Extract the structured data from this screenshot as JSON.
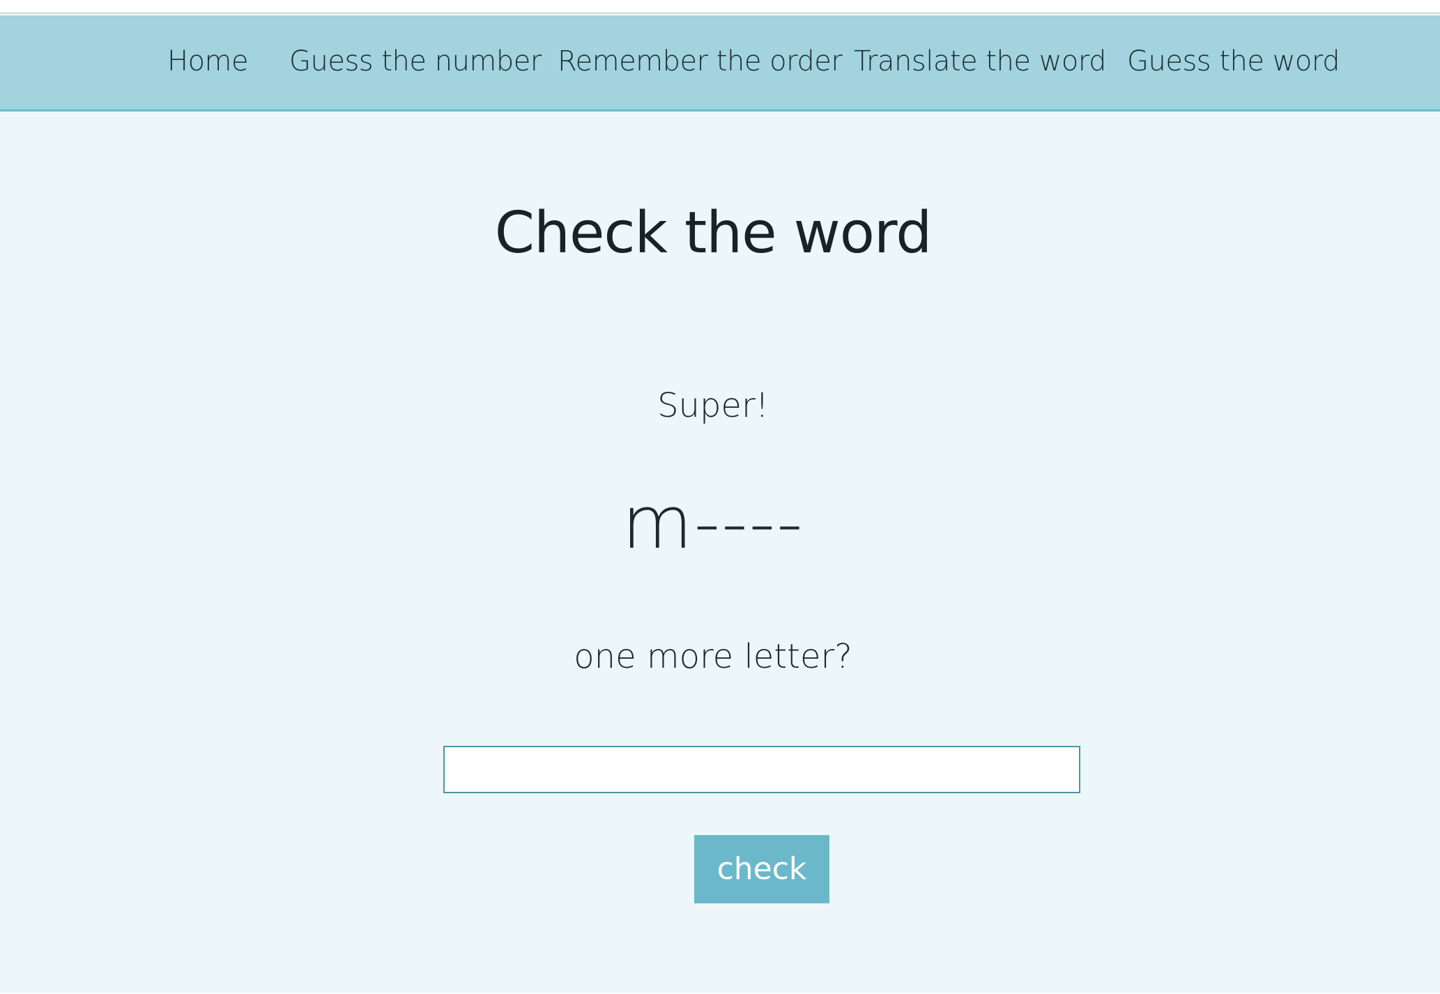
{
  "nav": {
    "items": [
      {
        "label": "Home"
      },
      {
        "label": "Guess the number"
      },
      {
        "label": "Remember the order"
      },
      {
        "label": "Translate the word"
      },
      {
        "label": "Guess the word"
      }
    ]
  },
  "main": {
    "title": "Check the word",
    "feedback": "Super!",
    "word_mask": "m----",
    "prompt": "one more letter?",
    "input": {
      "value": "",
      "placeholder": ""
    },
    "check_label": "check"
  },
  "colors": {
    "nav_background": "#a2d3de",
    "nav_border": "#6db9cb",
    "page_background": "#edf6f9",
    "button_background": "#6cb8cb",
    "input_border": "#4a96a6",
    "text": "#1a2a2e"
  }
}
